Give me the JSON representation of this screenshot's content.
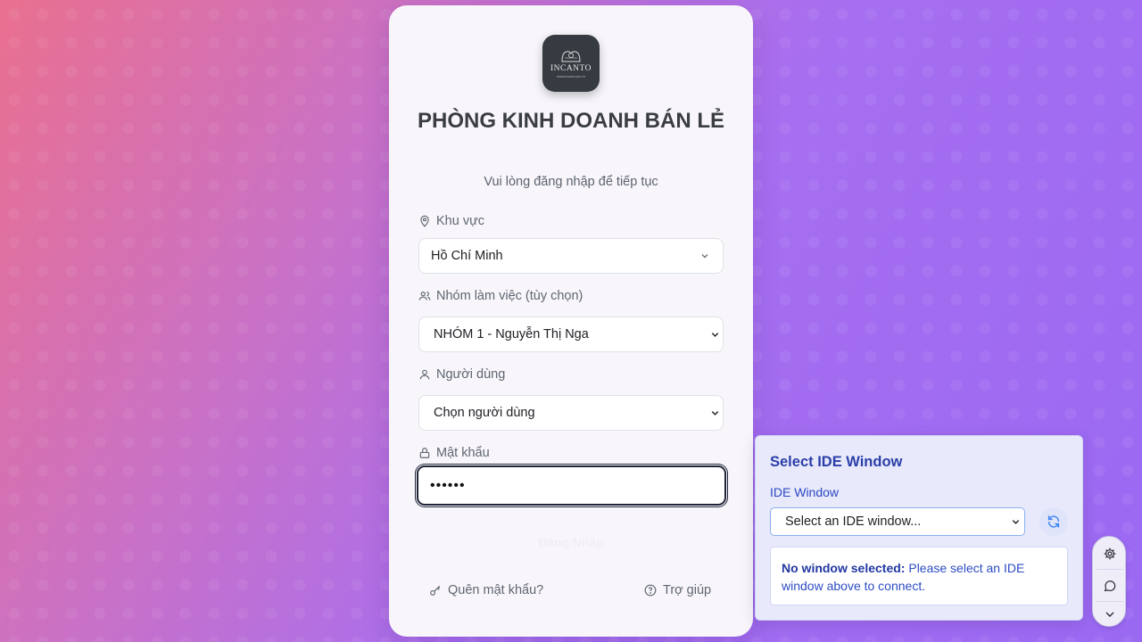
{
  "login": {
    "logo": {
      "brand": "INCANTO",
      "url": "www.incanto.com.vn",
      "icon": "incanto-logo"
    },
    "title": "PHÒNG KINH DOANH BÁN LẺ",
    "subtitle": "Vui lòng đăng nhập để tiếp tục",
    "region": {
      "label": "Khu vực",
      "icon": "location-pin-icon",
      "value": "Hồ Chí Minh"
    },
    "group": {
      "label": "Nhóm làm việc (tùy chọn)",
      "icon": "users-icon",
      "value": "NHÓM 1 - Nguyễn Thị Nga"
    },
    "user": {
      "label": "Người dùng",
      "icon": "user-icon",
      "value": "Chọn người dùng"
    },
    "password": {
      "label": "Mật khẩu",
      "icon": "lock-icon",
      "value": "••••••"
    },
    "submit_label": "Đăng Nhập",
    "forgot_label": "Quên mật khẩu?",
    "help_label": "Trợ giúp"
  },
  "ide_panel": {
    "title": "Select IDE Window",
    "field_label": "IDE Window",
    "select_placeholder": "Select an IDE window...",
    "notice_bold": "No window selected:",
    "notice_text": " Please select an IDE window above to connect."
  },
  "toolbar": {
    "items": [
      "gear-icon",
      "chat-icon",
      "chevron-down-icon"
    ]
  },
  "colors": {
    "accent": "#2b3fa8",
    "title_text": "#3a3d42",
    "focus_border": "#1f2438"
  }
}
